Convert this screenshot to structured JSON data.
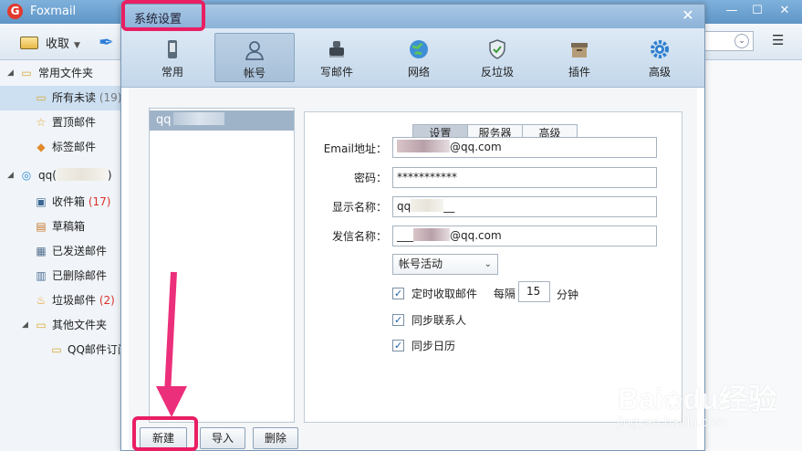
{
  "main_window": {
    "app_name": "Foxmail",
    "toolbar": {
      "receive_label": "收取"
    },
    "window_controls": {
      "minimize": "—",
      "maximize": "☐",
      "close": "✕"
    },
    "folders": [
      {
        "label": "常用文件夹",
        "count": "",
        "icon": "folder-icon",
        "level": 0,
        "expanded": true
      },
      {
        "label": "所有未读",
        "count": "(19)",
        "icon": "folder-icon",
        "level": 1,
        "selected": true
      },
      {
        "label": "置顶邮件",
        "count": "",
        "icon": "star-icon",
        "level": 1
      },
      {
        "label": "标签邮件",
        "count": "",
        "icon": "tag-icon",
        "level": 1
      },
      {
        "label": "qq(",
        "suffix": ")",
        "count": "",
        "icon": "account-icon",
        "level": 0,
        "expanded": true
      },
      {
        "label": "收件箱",
        "count": "(17)",
        "icon": "inbox-icon",
        "level": 1
      },
      {
        "label": "草稿箱",
        "count": "",
        "icon": "drafts-icon",
        "level": 1
      },
      {
        "label": "已发送邮件",
        "count": "",
        "icon": "sent-icon",
        "level": 1
      },
      {
        "label": "已删除邮件",
        "count": "",
        "icon": "trash-icon",
        "level": 1
      },
      {
        "label": "垃圾邮件",
        "count": "(2)",
        "icon": "spam-icon",
        "level": 1
      },
      {
        "label": "其他文件夹",
        "count": "",
        "icon": "folder-icon",
        "level": 1,
        "expanded": true
      },
      {
        "label": "QQ邮件订阅",
        "count": "",
        "icon": "folder-icon",
        "level": 2
      }
    ]
  },
  "dialog": {
    "title": "系统设置",
    "close": "✕",
    "tools": [
      {
        "label": "常用",
        "icon": "phone-icon"
      },
      {
        "label": "帐号",
        "icon": "user-icon",
        "active": true
      },
      {
        "label": "写邮件",
        "icon": "ink-stamp-icon"
      },
      {
        "label": "网络",
        "icon": "globe-icon"
      },
      {
        "label": "反垃圾",
        "icon": "shield-icon"
      },
      {
        "label": "插件",
        "icon": "box-icon"
      },
      {
        "label": "高级",
        "icon": "gear-icon"
      }
    ],
    "account_list": {
      "selected_account": "qq"
    },
    "buttons": {
      "new": "新建",
      "import": "导入",
      "delete": "删除"
    },
    "subtabs": [
      {
        "label": "设置",
        "active": true
      },
      {
        "label": "服务器"
      },
      {
        "label": "高级"
      }
    ],
    "form": {
      "email_label": "Email地址：",
      "email_value": "@qq.com",
      "password_label": "密码：",
      "password_value": "***********",
      "display_name_label": "显示名称：",
      "display_name_prefix": "qq",
      "display_name_suffix": "__",
      "sender_name_label": "发信名称：",
      "sender_name_prefix": "___",
      "sender_name_value": "@qq.com",
      "account_status": "帐号活动",
      "timed_receive_label": "定时收取邮件",
      "interval_label": "每隔",
      "interval_value": "15",
      "interval_unit": "分钟",
      "sync_contacts_label": "同步联系人",
      "sync_calendar_label": "同步日历",
      "timed_receive_checked": true,
      "sync_contacts_checked": true,
      "sync_calendar_checked": true
    }
  },
  "watermark": {
    "brand": "Bai",
    "brand2": "du",
    "product": "经验",
    "url": "jingyan.baidu.com"
  },
  "colors": {
    "highlight": "#e91e63",
    "arrow": "#ec2f7a",
    "selected_row": "#9fb3c8"
  }
}
